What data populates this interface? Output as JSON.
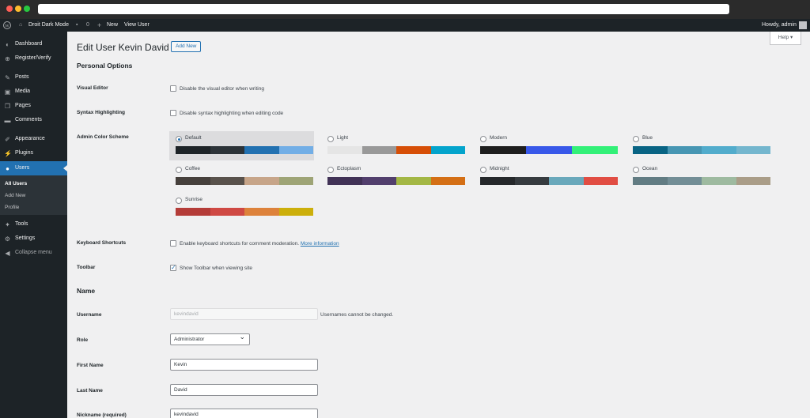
{
  "browser": {
    "traffic_lights": [
      "#ff5f57",
      "#febc2e",
      "#28c840"
    ]
  },
  "admin_bar": {
    "site_name": "Droit Dark Mode",
    "comments_count": "0",
    "new_label": "New",
    "view_user_label": "View User",
    "howdy": "Howdy, admin"
  },
  "sidebar": {
    "items": [
      {
        "label": "Dashboard",
        "icon": "dashboard-icon"
      },
      {
        "label": "Register/Verify",
        "icon": "register-icon"
      },
      {
        "label": "Posts",
        "icon": "pin-icon"
      },
      {
        "label": "Media",
        "icon": "media-icon"
      },
      {
        "label": "Pages",
        "icon": "pages-icon"
      },
      {
        "label": "Comments",
        "icon": "comment-icon"
      },
      {
        "label": "Appearance",
        "icon": "brush-icon"
      },
      {
        "label": "Plugins",
        "icon": "plugin-icon"
      },
      {
        "label": "Users",
        "icon": "users-icon"
      },
      {
        "label": "Tools",
        "icon": "wrench-icon"
      },
      {
        "label": "Settings",
        "icon": "settings-icon"
      },
      {
        "label": "Collapse menu",
        "icon": "collapse-icon"
      }
    ],
    "submenu": [
      "All Users",
      "Add New",
      "Profile"
    ]
  },
  "page": {
    "title": "Edit User Kevin David",
    "add_new": "Add New",
    "help": "Help"
  },
  "personal_options": {
    "heading": "Personal Options",
    "visual_editor_label": "Visual Editor",
    "visual_editor_text": "Disable the visual editor when writing",
    "syntax_label": "Syntax Highlighting",
    "syntax_text": "Disable syntax highlighting when editing code",
    "color_scheme_label": "Admin Color Scheme",
    "schemes": [
      {
        "name": "Default",
        "colors": [
          "#1d2327",
          "#2c3338",
          "#2271b1",
          "#72aee6"
        ]
      },
      {
        "name": "Light",
        "colors": [
          "#e5e5e5",
          "#999999",
          "#d64e07",
          "#04a4cc"
        ]
      },
      {
        "name": "Modern",
        "colors": [
          "#1e1e1e",
          "#3858e9",
          "#33f078"
        ]
      },
      {
        "name": "Blue",
        "colors": [
          "#096484",
          "#4796b3",
          "#52accc",
          "#74b6ce"
        ]
      },
      {
        "name": "Coffee",
        "colors": [
          "#46403c",
          "#59524c",
          "#c7a589",
          "#9ea476"
        ]
      },
      {
        "name": "Ectoplasm",
        "colors": [
          "#413256",
          "#523f6d",
          "#a3b745",
          "#d46f15"
        ]
      },
      {
        "name": "Midnight",
        "colors": [
          "#25282b",
          "#363b3f",
          "#69a8bb",
          "#e14d43"
        ]
      },
      {
        "name": "Ocean",
        "colors": [
          "#627c83",
          "#738e96",
          "#9ebaa0",
          "#aa9d88"
        ]
      },
      {
        "name": "Sunrise",
        "colors": [
          "#b43c38",
          "#cf4944",
          "#dd823b",
          "#ccaf0b"
        ]
      }
    ],
    "keyboard_label": "Keyboard Shortcuts",
    "keyboard_text": "Enable keyboard shortcuts for comment moderation.",
    "keyboard_link": "More information",
    "toolbar_label": "Toolbar",
    "toolbar_text": "Show Toolbar when viewing site"
  },
  "name_section": {
    "heading": "Name",
    "username_label": "Username",
    "username_value": "kevindavid",
    "username_note": "Usernames cannot be changed.",
    "role_label": "Role",
    "role_value": "Administrator",
    "first_name_label": "First Name",
    "first_name_value": "Kevin",
    "last_name_label": "Last Name",
    "last_name_value": "David",
    "nickname_label": "Nickname (required)",
    "nickname_value": "kevindavid"
  }
}
